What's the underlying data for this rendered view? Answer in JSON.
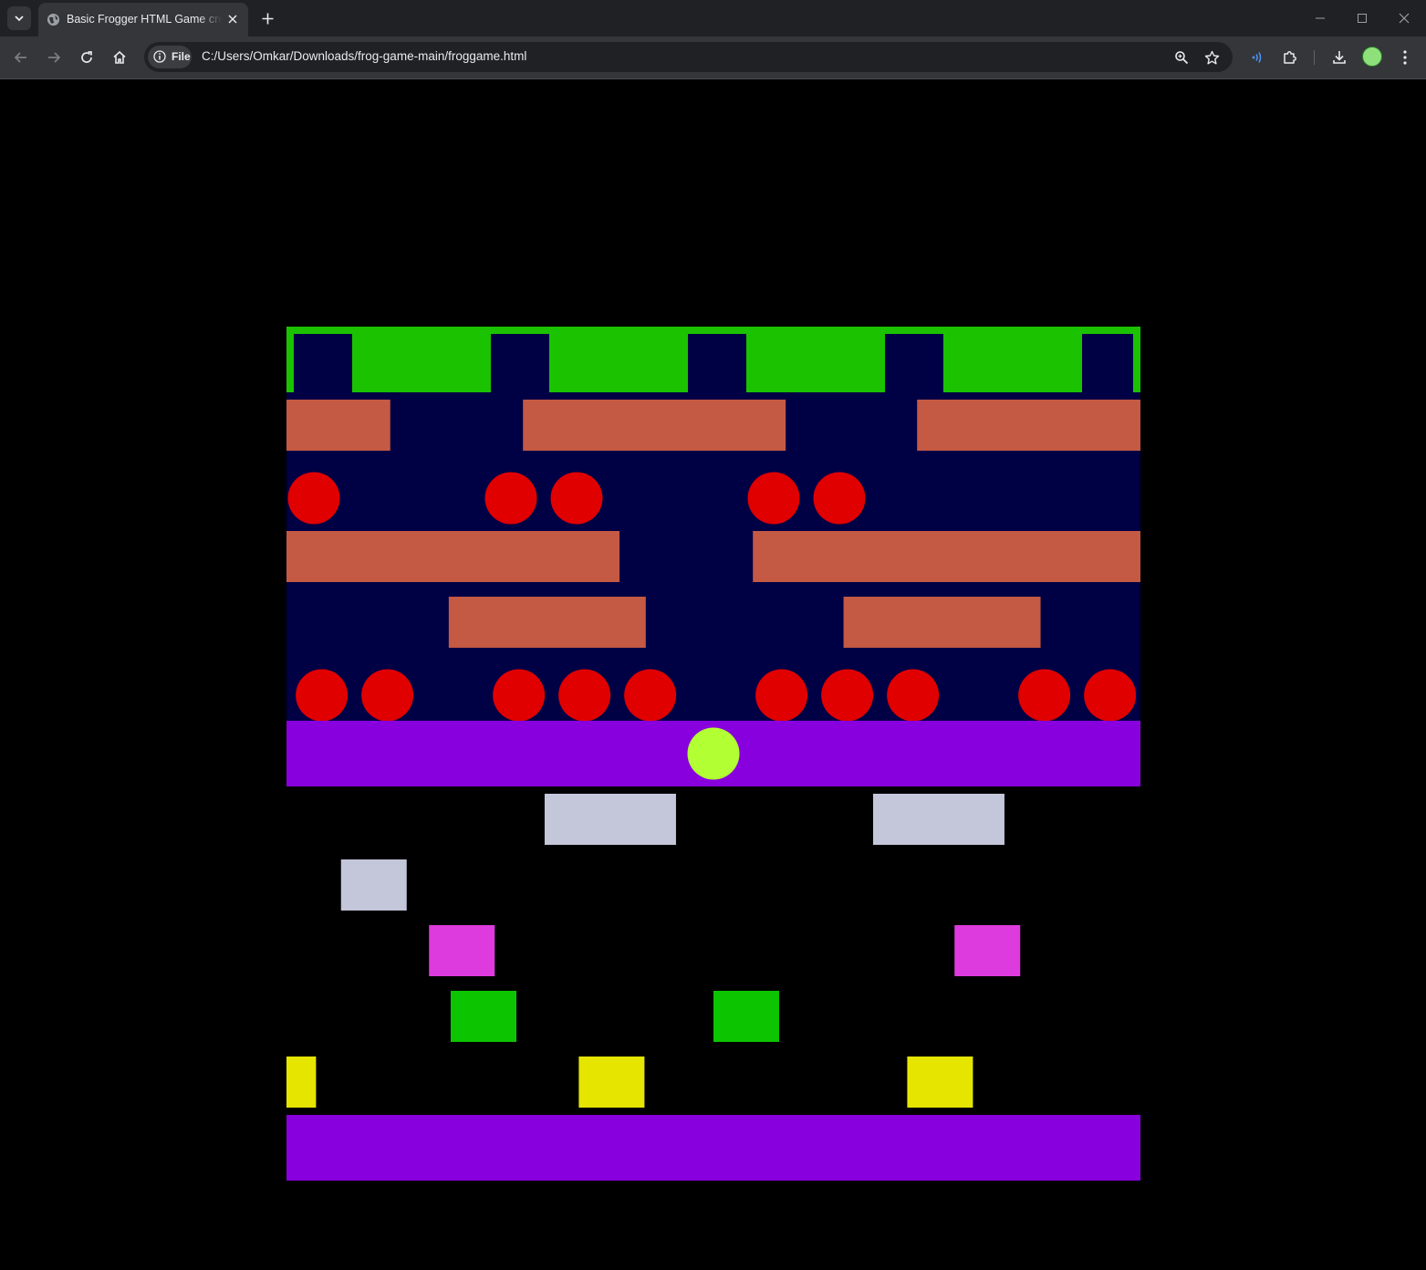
{
  "browser": {
    "tab": {
      "title": "Basic Frogger HTML Game created"
    },
    "address_bar": {
      "chip_label": "File",
      "url": "C:/Users/Omkar/Downloads/frog-game-main/froggame.html"
    },
    "icons": {
      "tab_menu": "chevron-down-icon",
      "favicon": "globe-icon",
      "tab_close": "close-icon",
      "new_tab": "plus-icon",
      "back": "arrow-left-icon",
      "forward": "arrow-right-icon",
      "reload": "reload-icon",
      "home": "home-icon",
      "site_info": "info-icon",
      "zoom": "zoom-icon",
      "bookmark": "star-icon",
      "extension_active": "signal-waves-icon",
      "extensions": "puzzle-icon",
      "downloads": "download-icon",
      "profile": "avatar",
      "menu": "kebab-menu-icon",
      "minimize": "minimize-icon",
      "maximize": "maximize-icon",
      "close_window": "close-icon"
    }
  },
  "game": {
    "grid": {
      "columns": 13,
      "rows": 13
    },
    "colors": {
      "background": "#000000",
      "water": "#000044",
      "home_grass": "#1bc200",
      "log": "#c45944",
      "turtle": "#e00000",
      "safe_strip": "#8800dd",
      "frog": "#b2ff33",
      "car_white": "#c4c6da",
      "car_pink": "#dd3bdd",
      "car_green": "#0dc400",
      "car_yellow": "#e5e500"
    },
    "goal_bays": [
      0,
      3,
      6,
      9,
      12
    ],
    "logs": [
      {
        "row": 1,
        "col": 0,
        "length": 1.58
      },
      {
        "row": 1,
        "col": 3.6,
        "length": 4
      },
      {
        "row": 1,
        "col": 9.6,
        "length": 3.4
      },
      {
        "row": 3,
        "col": 0,
        "length": 5.07
      },
      {
        "row": 3,
        "col": 7.1,
        "length": 5.9
      },
      {
        "row": 4,
        "col": 2.47,
        "length": 3
      },
      {
        "row": 4,
        "col": 8.48,
        "length": 3
      }
    ],
    "turtles": [
      {
        "row": 2,
        "cols": [
          0,
          3,
          4,
          7,
          8
        ]
      },
      {
        "row": 5,
        "cols": [
          0.12,
          1.12,
          3.12,
          4.12,
          5.12,
          7.12,
          8.12,
          9.12,
          11.12,
          12.12
        ]
      }
    ],
    "safe_rows": [
      6,
      12
    ],
    "frog": {
      "row": 6,
      "col": 6
    },
    "cars": [
      {
        "row": 7,
        "col": 3.93,
        "length": 2,
        "color": "car_white"
      },
      {
        "row": 7,
        "col": 8.93,
        "length": 2,
        "color": "car_white"
      },
      {
        "row": 8,
        "col": 0.83,
        "length": 1,
        "color": "car_white"
      },
      {
        "row": 9,
        "col": 2.17,
        "length": 1,
        "color": "car_pink"
      },
      {
        "row": 9,
        "col": 10.17,
        "length": 1,
        "color": "car_pink"
      },
      {
        "row": 10,
        "col": 2.5,
        "length": 1,
        "color": "car_green"
      },
      {
        "row": 10,
        "col": 6.5,
        "length": 1,
        "color": "car_green"
      },
      {
        "row": 11,
        "col": 0,
        "length": 0.45,
        "color": "car_yellow"
      },
      {
        "row": 11,
        "col": 4.45,
        "length": 1,
        "color": "car_yellow"
      },
      {
        "row": 11,
        "col": 9.45,
        "length": 1,
        "color": "car_yellow"
      }
    ]
  }
}
